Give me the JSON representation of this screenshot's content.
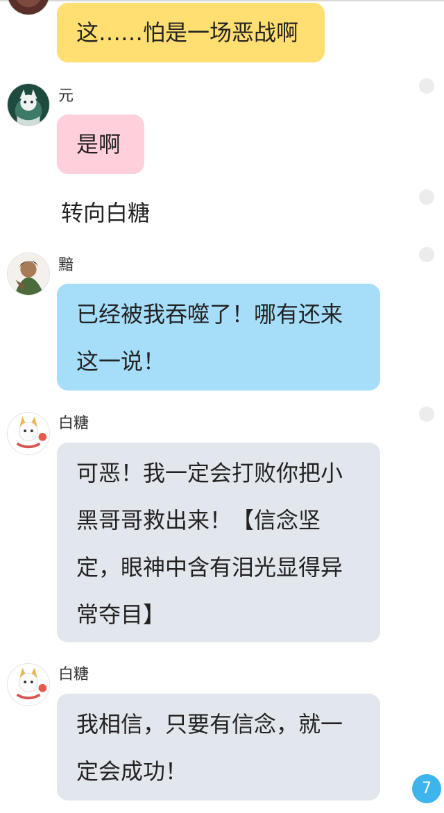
{
  "messages": [
    {
      "speaker": "",
      "text": "这……怕是一场恶战啊"
    },
    {
      "speaker": "元",
      "text": "是啊"
    },
    {
      "narration": "转向白糖"
    },
    {
      "speaker": "黯",
      "text": "已经被我吞噬了！哪有还来这一说！"
    },
    {
      "speaker": "白糖",
      "text": "可恶！我一定会打败你把小黑哥哥救出来！【信念坚定，眼神中含有泪光显得异常夺目】"
    },
    {
      "speaker": "白糖",
      "text": "我相信，只要有信念，就一定会成功！"
    }
  ],
  "unread_badge": "7",
  "colors": {
    "bubble_yellow": "#ffdf72",
    "bubble_pink": "#ffcfdc",
    "bubble_blue": "#a6defa",
    "bubble_grey": "#e2e6ed",
    "badge": "#3db4ec"
  },
  "icons": {
    "avatar_yuan": "avatar-cat-spirit-icon",
    "avatar_an": "avatar-dark-warrior-icon",
    "avatar_baitang": "avatar-white-cat-icon"
  }
}
